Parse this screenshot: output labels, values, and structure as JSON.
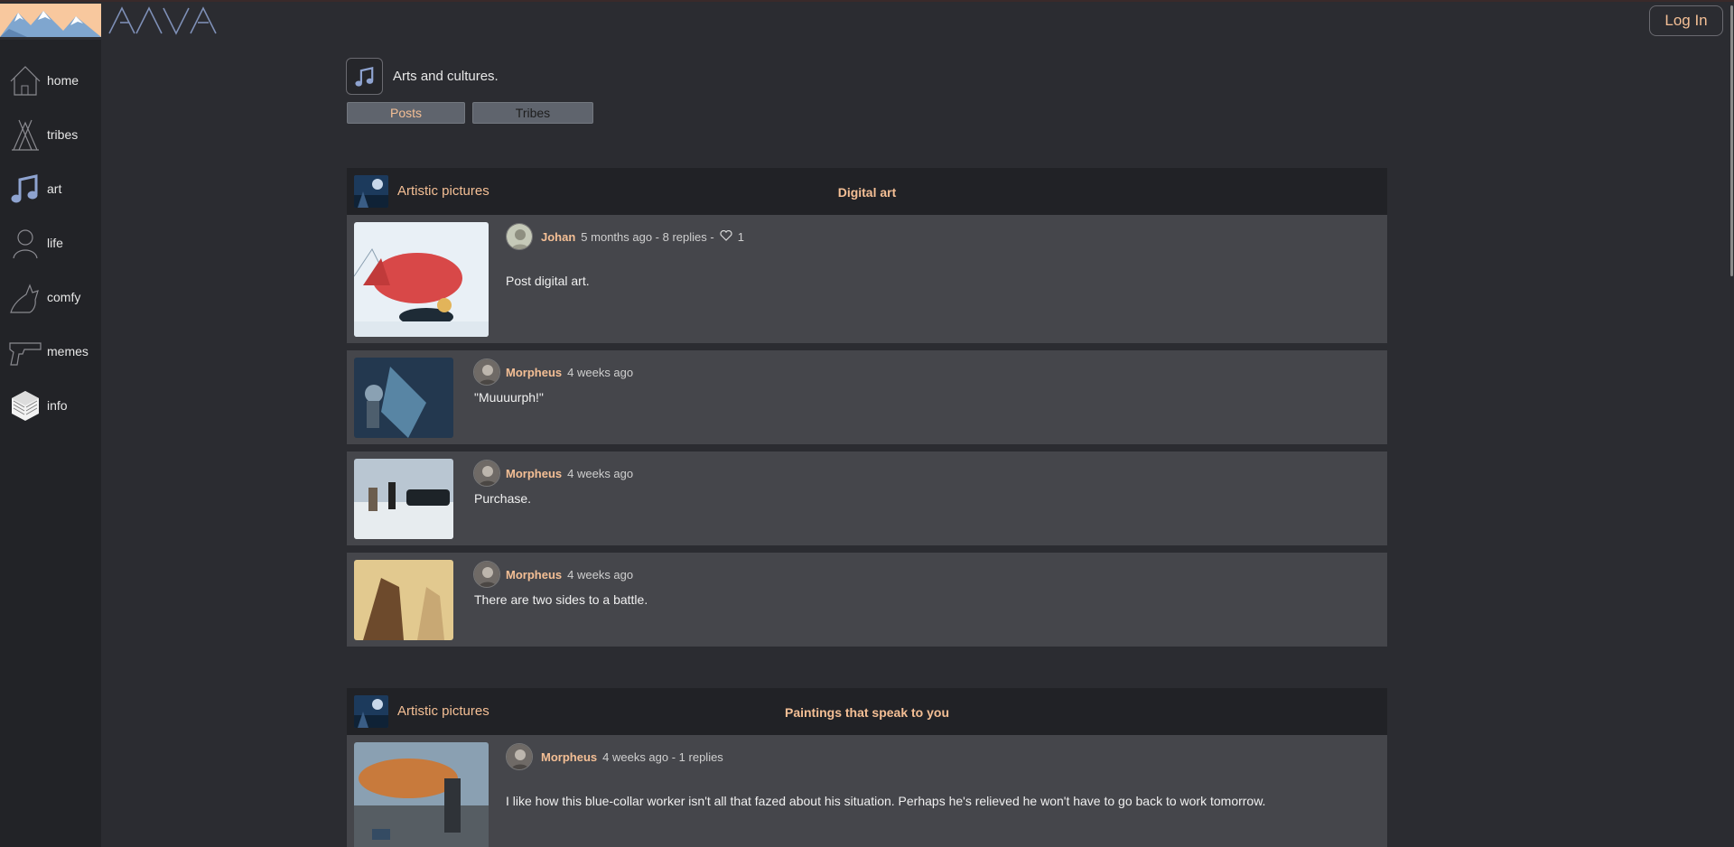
{
  "app": {
    "wordmark": "AAVA"
  },
  "header": {
    "login_label": "Log In"
  },
  "sidebar": {
    "items": [
      {
        "label": "home",
        "icon": "house-icon"
      },
      {
        "label": "tribes",
        "icon": "teepee-icon"
      },
      {
        "label": "art",
        "icon": "music-note-icon"
      },
      {
        "label": "life",
        "icon": "person-icon"
      },
      {
        "label": "comfy",
        "icon": "cat-icon"
      },
      {
        "label": "memes",
        "icon": "pistol-icon"
      },
      {
        "label": "info",
        "icon": "book-icon"
      }
    ]
  },
  "tribe": {
    "description": "Arts and cultures.",
    "tabs": [
      {
        "label": "Posts"
      },
      {
        "label": "Tribes"
      }
    ]
  },
  "threads": [
    {
      "tribe_name": "Artistic pictures",
      "title": "Digital art",
      "posts": [
        {
          "user": "Johan",
          "meta": "5 months ago - 8 replies -",
          "likes": "1",
          "text": "Post digital art."
        },
        {
          "user": "Morpheus",
          "meta": "4 weeks ago",
          "text": "\"Muuuurph!\""
        },
        {
          "user": "Morpheus",
          "meta": "4 weeks ago",
          "text": "Purchase."
        },
        {
          "user": "Morpheus",
          "meta": "4 weeks ago",
          "text": "There are two sides to a battle."
        }
      ]
    },
    {
      "tribe_name": "Artistic pictures",
      "title": "Paintings that speak to you",
      "posts": [
        {
          "user": "Morpheus",
          "meta": "4 weeks ago - 1 replies",
          "text": "I like how this blue-collar worker isn't all that fazed about his situation. Perhaps he's relieved he won't have to go back to work tomorrow."
        }
      ]
    }
  ],
  "colors": {
    "accent": "#f4bf95",
    "background": "#2b2c31",
    "sidebar": "#222327",
    "post": "#45464b"
  }
}
